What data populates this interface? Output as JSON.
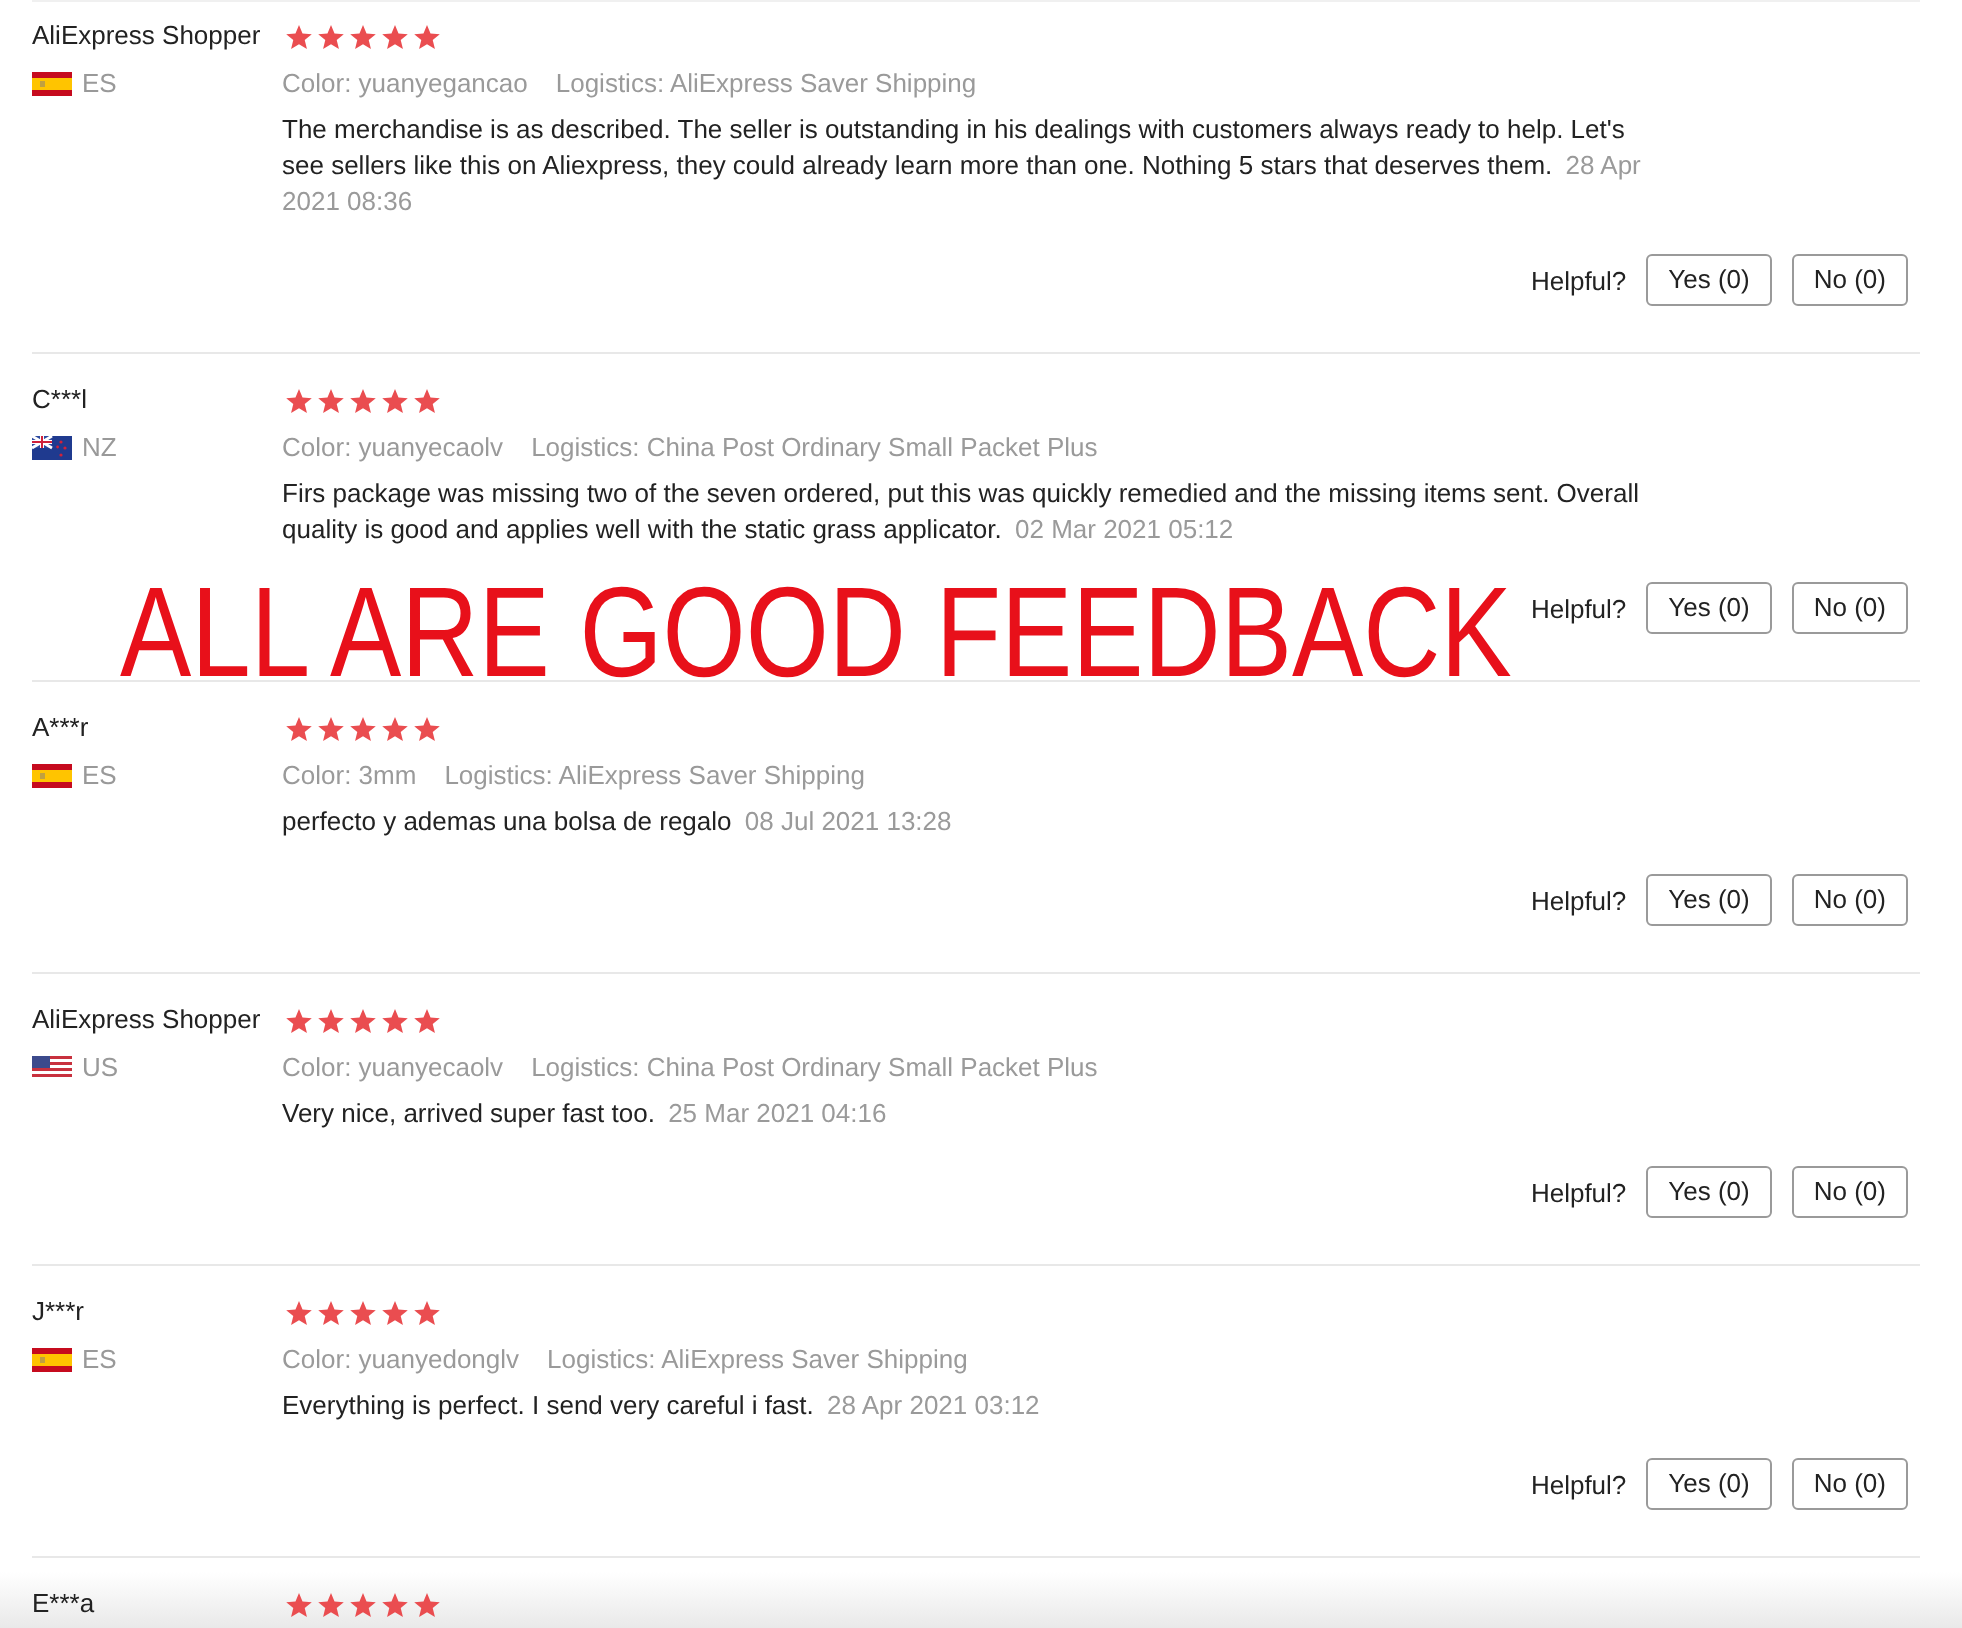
{
  "overlay_caption": "ALL ARE GOOD FEEDBACK",
  "reviews": [
    {
      "author": "AliExpress Shopper",
      "flag": {
        "kind": "es"
      },
      "country": "ES",
      "stars": 5,
      "color_option": "Color: yuanyegancao",
      "logistics": "Logistics: AliExpress Saver Shipping",
      "text": "The merchandise is as described. The seller is outstanding in his dealings with customers always ready to help. Let's see sellers like this on Aliexpress, they could already learn more than one. Nothing 5 stars that deserves them.",
      "date": "28 Apr 2021 08:36",
      "helpful_label": "Helpful?",
      "yes_button": "Yes (0)",
      "no_button": "No (0)"
    },
    {
      "author": "C***l",
      "flag": {
        "kind": "nz"
      },
      "country": "NZ",
      "stars": 5,
      "color_option": "Color: yuanyecaolv",
      "logistics": "Logistics: China Post Ordinary Small Packet Plus",
      "text": "Firs package was missing two of the seven ordered, put this was quickly remedied and the missing items sent. Overall quality is good and applies well with the static grass applicator.",
      "date": "02 Mar 2021 05:12",
      "helpful_label": "Helpful?",
      "yes_button": "Yes (0)",
      "no_button": "No (0)"
    },
    {
      "author": "A***r",
      "flag": {
        "kind": "es"
      },
      "country": "ES",
      "stars": 5,
      "color_option": "Color: 3mm",
      "logistics": "Logistics: AliExpress Saver Shipping",
      "text": "perfecto y ademas una bolsa de regalo",
      "date": "08 Jul 2021 13:28",
      "helpful_label": "Helpful?",
      "yes_button": "Yes (0)",
      "no_button": "No (0)"
    },
    {
      "author": "AliExpress Shopper",
      "flag": {
        "kind": "us"
      },
      "country": "US",
      "stars": 5,
      "color_option": "Color: yuanyecaolv",
      "logistics": "Logistics: China Post Ordinary Small Packet Plus",
      "text": "Very nice, arrived super fast too.",
      "date": "25 Mar 2021 04:16",
      "helpful_label": "Helpful?",
      "yes_button": "Yes (0)",
      "no_button": "No (0)"
    },
    {
      "author": "J***r",
      "flag": {
        "kind": "es"
      },
      "country": "ES",
      "stars": 5,
      "color_option": "Color: yuanyedonglv",
      "logistics": "Logistics: AliExpress Saver Shipping",
      "text": "Everything is perfect. I send very careful i fast.",
      "date": "28 Apr 2021 03:12",
      "helpful_label": "Helpful?",
      "yes_button": "Yes (0)",
      "no_button": "No (0)"
    },
    {
      "author": "E***a",
      "stars": 5
    }
  ]
}
